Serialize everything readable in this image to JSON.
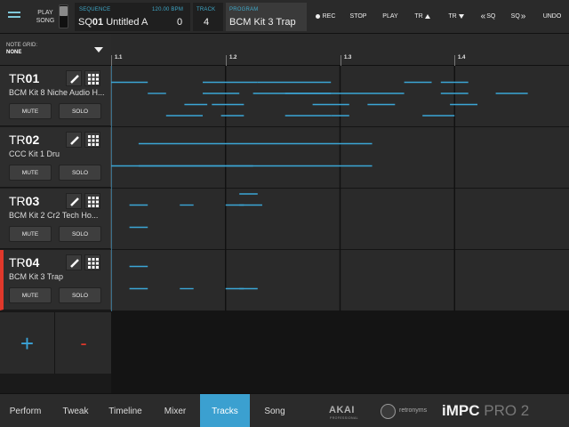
{
  "topbar": {
    "playsong_label": "PLAY SONG",
    "sequence_caption": "SEQUENCE",
    "bpm": "120.00 BPM",
    "sequence_prefix": "SQ",
    "sequence_number": "01",
    "sequence_name": "Untitled A",
    "sequence_value": "0",
    "track_caption": "TRACK",
    "track_value": "4",
    "program_caption": "PROGRAM",
    "program_value": "BCM Kit 3 Trap",
    "rec_label": "REC",
    "stop_label": "STOP",
    "play_label": "PLAY",
    "tr_up_label": "TR",
    "tr_down_label": "TR",
    "sq_prev_label": "SQ",
    "sq_next_label": "SQ",
    "undo_label": "UNDO"
  },
  "note_grid": {
    "caption": "NOTE GRID:",
    "value": "NONE"
  },
  "ruler": {
    "marks": [
      "1.1",
      "1.2",
      "1.3",
      "1.4"
    ]
  },
  "tracks": [
    {
      "prefix": "TR",
      "number": "01",
      "kit": "BCM Kit 8 Niche Audio H...",
      "mute": "MUTE",
      "solo": "SOLO",
      "selected": false
    },
    {
      "prefix": "TR",
      "number": "02",
      "kit": "CCC Kit 1 Dru",
      "mute": "MUTE",
      "solo": "SOLO",
      "selected": false
    },
    {
      "prefix": "TR",
      "number": "03",
      "kit": "BCM Kit 2 Cr2 Tech Ho...",
      "mute": "MUTE",
      "solo": "SOLO",
      "selected": false
    },
    {
      "prefix": "TR",
      "number": "04",
      "kit": "BCM Kit 3 Trap",
      "mute": "MUTE",
      "solo": "SOLO",
      "selected": true
    }
  ],
  "add_remove": {
    "add": "+",
    "remove": "-"
  },
  "bottom_tabs": [
    "Perform",
    "Tweak",
    "Timeline",
    "Mixer",
    "Tracks",
    "Song"
  ],
  "active_tab": "Tracks",
  "branding": {
    "akai": "AKAI",
    "akai_sub": "PROFESSIONAL",
    "retronyms": "retronyms",
    "impc": "iMPC",
    "pro2": "PRO 2"
  },
  "colors": {
    "accent": "#3ba0d0",
    "note": "#3ba6d6",
    "selected_track": "#e0382b"
  },
  "notes": {
    "track_01": [
      [
        0,
        0.08,
        1
      ],
      [
        0.08,
        0.1,
        2
      ],
      [
        0.1,
        0.12,
        2
      ],
      [
        0.12,
        0.2,
        4
      ],
      [
        0.16,
        0.21,
        3
      ],
      [
        0.2,
        0.32,
        1
      ],
      [
        0.2,
        0.28,
        2
      ],
      [
        0.22,
        0.29,
        3
      ],
      [
        0.24,
        0.29,
        4
      ],
      [
        0.31,
        0.64,
        2
      ],
      [
        0.32,
        0.48,
        1
      ],
      [
        0.38,
        0.48,
        4
      ],
      [
        0.38,
        0.48,
        2
      ],
      [
        0.44,
        0.52,
        3
      ],
      [
        0.48,
        0.52,
        4
      ],
      [
        0.56,
        0.62,
        3
      ],
      [
        0.64,
        0.7,
        1
      ],
      [
        0.68,
        0.75,
        4
      ],
      [
        0.72,
        0.78,
        2
      ],
      [
        0.72,
        0.78,
        1
      ],
      [
        0.74,
        0.8,
        3
      ],
      [
        0.84,
        0.91,
        2
      ]
    ],
    "track_02": [
      [
        0,
        0.31,
        3
      ],
      [
        0.06,
        0.57,
        1
      ],
      [
        0.06,
        0.57,
        3
      ]
    ],
    "track_03": [
      [
        0.04,
        0.08,
        1
      ],
      [
        0.04,
        0.08,
        3
      ],
      [
        0.15,
        0.18,
        1
      ],
      [
        0.25,
        0.29,
        1
      ],
      [
        0.28,
        0.32,
        0
      ],
      [
        0.28,
        0.33,
        1
      ]
    ],
    "track_04": [
      [
        0.04,
        0.08,
        1
      ],
      [
        0.04,
        0.08,
        3
      ],
      [
        0.15,
        0.18,
        3
      ],
      [
        0.25,
        0.29,
        3
      ],
      [
        0.28,
        0.32,
        3
      ]
    ]
  }
}
